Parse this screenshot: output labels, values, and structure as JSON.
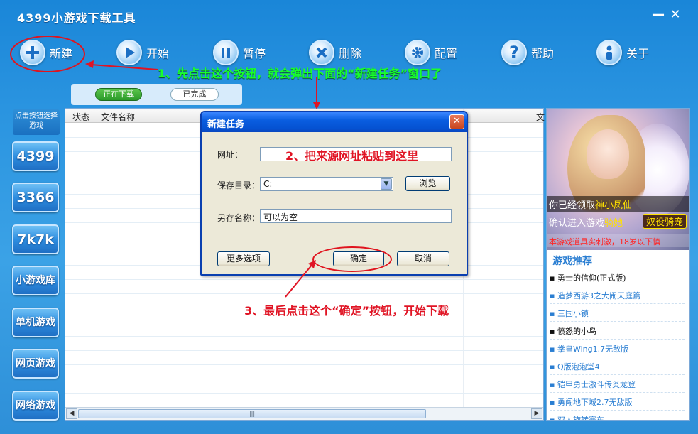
{
  "app": {
    "title": "4399小游戏下载工具",
    "min_glyph": "—",
    "close_glyph": "✕"
  },
  "toolbar": {
    "new_label": "新建",
    "start_label": "开始",
    "pause_label": "暂停",
    "delete_label": "删除",
    "config_label": "配置",
    "help_label": "帮助",
    "about_label": "关于",
    "icons": {
      "new": "plus-icon",
      "start": "play-icon",
      "pause": "pause-icon",
      "delete": "delete-x-icon",
      "config": "gear-icon",
      "help": "help-question-icon",
      "about": "person-info-icon"
    }
  },
  "annotations": {
    "step1": "1、先点击这个按钮，就会弹出下面的“新建任务”窗口了",
    "step2": "2、把来源网址粘贴到这里",
    "step3": "3、最后点击这个“确定”按钮，开始下载"
  },
  "tabs": {
    "downloading": "正在下载",
    "completed": "已完成"
  },
  "sidebar": {
    "hint": "点击按钮选择游戏",
    "items": [
      "4399",
      "3366",
      "7k7k",
      "小游戏库",
      "单机游戏",
      "网页游戏",
      "网络游戏"
    ]
  },
  "list": {
    "col_status": "状态",
    "col_filename": "文件名称",
    "col_partial": "文",
    "thumb_glyph": "|||"
  },
  "dialog": {
    "title": "新建任务",
    "url_label": "网址：",
    "save_dir_label": "保存目录：",
    "save_dir_value": "C:",
    "browse_button": "浏览",
    "save_as_label": "另存名称：",
    "save_as_value": "可以为空",
    "more_options_button": "更多选项",
    "ok_button": "确定",
    "cancel_button": "取消"
  },
  "promo": {
    "line1_prefix": "你已经领取",
    "line1_highlight": "神小凤仙",
    "line2_prefix": "确认进入游戏",
    "line2_highlight": "骑她",
    "line2_pill": "奴役骑宠",
    "line3": "本游戏道具实刺激，18岁以下慎"
  },
  "recommend": {
    "title": "游戏推荐",
    "items": [
      {
        "text": "▪ 勇士的信仰(正式版)",
        "color": "black"
      },
      {
        "text": "▪ 造梦西游3之大闹天庭篇",
        "color": "blue"
      },
      {
        "text": "▪ 三国小镇",
        "color": "blue"
      },
      {
        "text": "▪ 愤怒的小鸟",
        "color": "black"
      },
      {
        "text": "▪ 拳皇Wing1.7无敌版",
        "color": "blue"
      },
      {
        "text": "▪ Q版泡泡堂4",
        "color": "blue"
      },
      {
        "text": "▪ 铠甲勇士激斗传炎龙登",
        "color": "blue"
      },
      {
        "text": "▪ 勇闯地下城2.7无敌版",
        "color": "blue"
      },
      {
        "text": "▪ 双人旋转赛车",
        "color": "blue"
      }
    ]
  },
  "colors": {
    "annotation_red": "#e01424",
    "annotation_green": "#18ff2c",
    "accent_blue": "#2a7ed2"
  }
}
